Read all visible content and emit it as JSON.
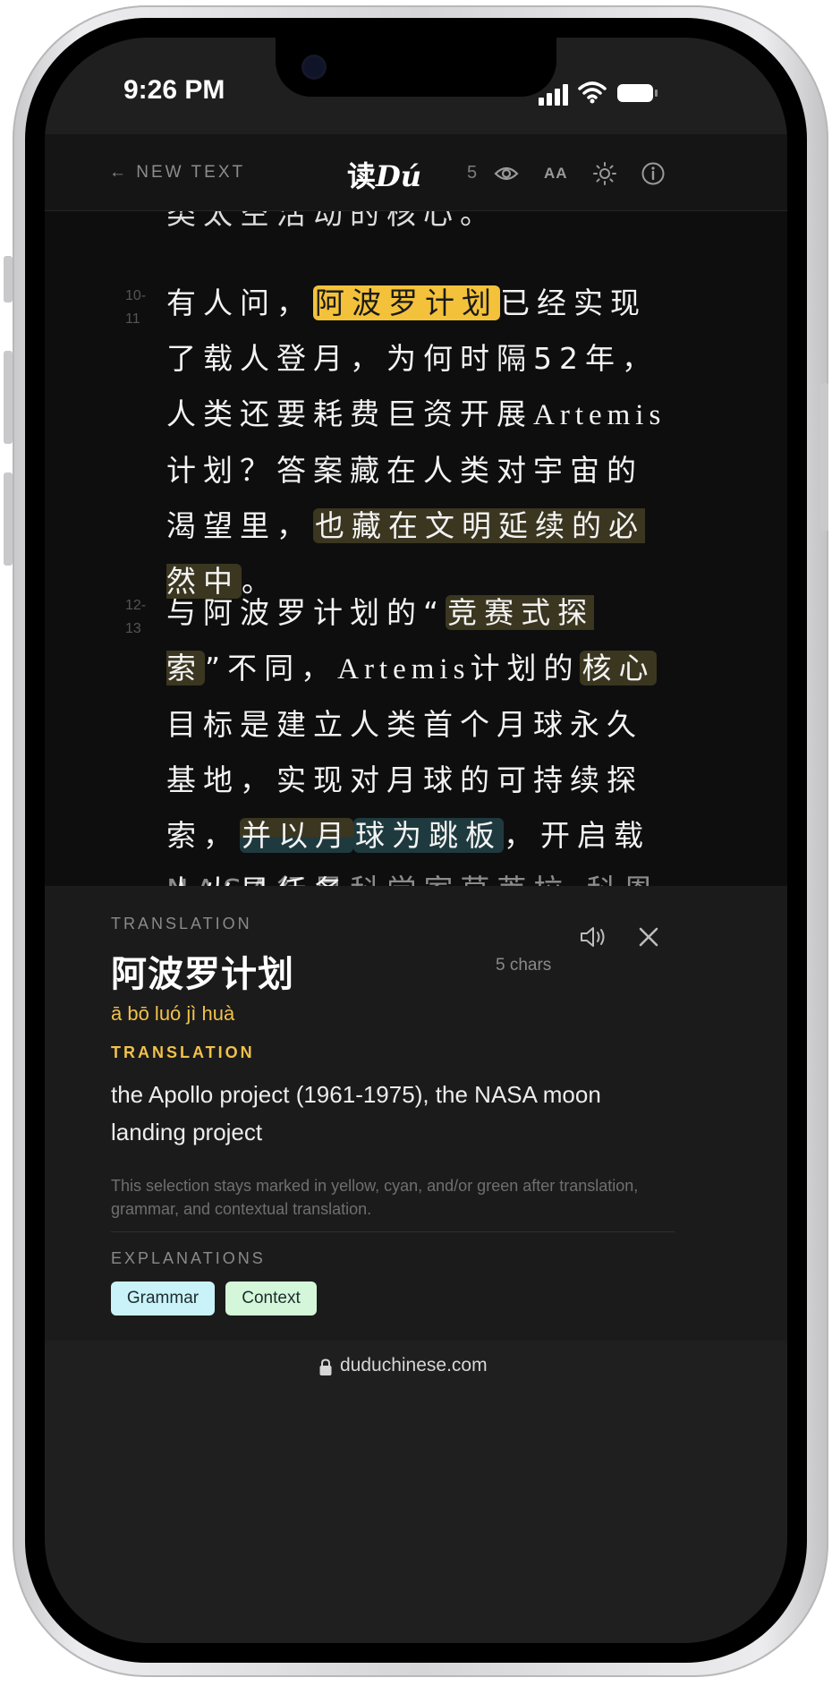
{
  "status_bar": {
    "time": "9:26 PM"
  },
  "header": {
    "back_label": "← NEW TEXT",
    "logo_cn": "读",
    "logo_latin": "Dú",
    "hsk_level": "5",
    "icons": [
      "eye-icon",
      "text-size-icon",
      "brightness-icon",
      "info-icon"
    ],
    "text_size_label": "AA"
  },
  "reading": {
    "faded_top": "类太空活动的核心。",
    "paragraphs": [
      {
        "lines_ref": "10-\n11",
        "line_label_a": "10-",
        "line_label_b": "11",
        "seg_1": "有人问，",
        "seg_2_highlight": "阿波罗计划",
        "seg_3": "已经实现了载人登月，为何时隔52年，人类还要耗费巨资开展",
        "seg_4_latin": "Artemis",
        "seg_5": "计划？答案藏在人类对宇宙的渴望里，",
        "seg_6_highlight": "也藏在文明延续的必然中",
        "seg_7": "。"
      },
      {
        "line_label_a": "12-",
        "line_label_b": "13",
        "seg_1": "与阿波罗计划的“",
        "seg_2_highlight": "竞赛式探索",
        "seg_3": "”不同，",
        "seg_4_latin": "Artemis",
        "seg_5": "计划的",
        "seg_6_highlight": "核心",
        "seg_7": "目标是建立人类首个月球永久基地，实现对月球的可持续探索，",
        "seg_8_highlight": "并以月",
        "seg_9_highlight": "球为跳板",
        "seg_10": "，开启载人火星任务。"
      }
    ],
    "faded_bottom": "NASA行星科学家草莘拉·科恩直"
  },
  "panel": {
    "eyebrow": "TRANSLATION",
    "word": "阿波罗计划",
    "char_count": "5 chars",
    "pinyin": "ā bō luó jì huà",
    "section_label": "TRANSLATION",
    "meaning": "the Apollo project (1961-1975), the NASA moon landing project",
    "note": "This selection stays marked in yellow, cyan, and/or green after translation, grammar, and contextual translation.",
    "explanations_label": "EXPLANATIONS",
    "chips": [
      "Grammar",
      "Context"
    ]
  },
  "browser": {
    "url": "duduchinese.com"
  },
  "colors": {
    "highlight_yellow": "#f3c23a",
    "highlight_olive": "#3b3620",
    "highlight_teal": "#1f3a3f",
    "accent_gold": "#f1c14a",
    "chip_cyan": "#c9f3f9",
    "chip_green": "#d4f7da"
  }
}
